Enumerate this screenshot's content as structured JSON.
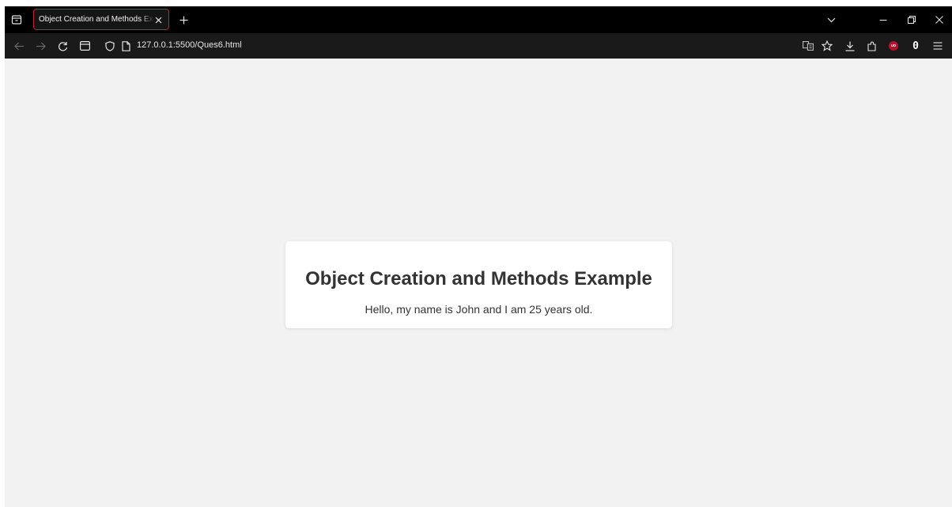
{
  "browser": {
    "tab": {
      "title": "Object Creation and Methods Example",
      "close_glyph": "✕"
    },
    "new_tab_glyph": "+",
    "address_bar": {
      "url": "127.0.0.1:5500/Ques6.html"
    },
    "toolbar_badge": "0",
    "colors": {
      "tab_border": "#c4242b",
      "tabbar_bg": "#000000",
      "navbar_bg": "#1a1a1a",
      "page_bg": "#f2f2f2"
    },
    "icons": [
      "tab-list-icon",
      "close-icon",
      "plus-icon",
      "chevron-down-icon",
      "minimize-icon",
      "restore-icon",
      "back-arrow-icon",
      "forward-arrow-icon",
      "reload-icon",
      "sidebar-icon",
      "shield-icon",
      "page-icon",
      "translate-icon",
      "star-icon",
      "download-icon",
      "extensions-icon",
      "ublock-icon",
      "menu-icon"
    ]
  },
  "page": {
    "heading": "Object Creation and Methods Example",
    "message": "Hello, my name is John and I am 25 years old."
  }
}
